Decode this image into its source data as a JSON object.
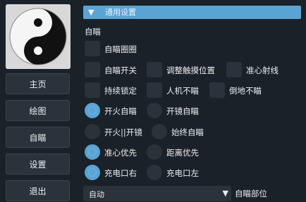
{
  "nav": {
    "items": [
      {
        "label": "主页"
      },
      {
        "label": "绘图"
      },
      {
        "label": "自瞄"
      },
      {
        "label": "设置"
      },
      {
        "label": "退出"
      }
    ]
  },
  "header": {
    "arrow": "▼",
    "title": "通用设置"
  },
  "section": {
    "title": "自瞄"
  },
  "options": {
    "aim_circle": {
      "label": "自瞄圈圈",
      "checked": false
    },
    "aim_switch": {
      "label": "自瞄开关",
      "checked": false
    },
    "adjust_touch": {
      "label": "调整触摸位置",
      "checked": false
    },
    "crosshair_ray": {
      "label": "准心射线",
      "checked": false
    },
    "continuous_lock": {
      "label": "持续锁定",
      "checked": false
    },
    "no_bot_aim": {
      "label": "人机不瞄",
      "checked": false
    },
    "no_downed_aim": {
      "label": "倒地不瞄",
      "checked": false
    }
  },
  "radios": {
    "fire_aim": {
      "label": "开火自瞄",
      "selected": true
    },
    "scope_aim": {
      "label": "开镜自瞄",
      "selected": false
    },
    "fire_or_scope": {
      "label": "开火||开镜",
      "selected": false
    },
    "always_aim": {
      "label": "始终自瞄",
      "selected": false
    },
    "crosshair_priority": {
      "label": "准心优先",
      "selected": true
    },
    "distance_priority": {
      "label": "距离优先",
      "selected": false
    },
    "charge_right": {
      "label": "充电口右",
      "selected": true
    },
    "charge_left": {
      "label": "充电口左",
      "selected": false
    }
  },
  "aim_part": {
    "value": "自动",
    "arrow": "▼",
    "label": "自瞄部位"
  },
  "colors": {
    "accent": "#5aa4d4",
    "control_bg": "#2b323b",
    "background": "#1b2128"
  },
  "icons": {
    "logo": "yin-yang-icon"
  }
}
